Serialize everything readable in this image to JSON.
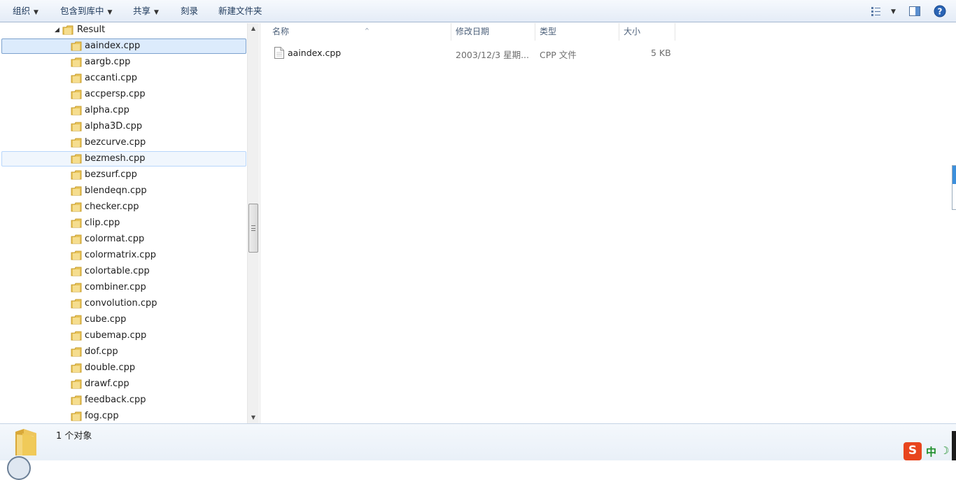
{
  "toolbar": {
    "organize": "组织",
    "include_in_library": "包含到库中",
    "share": "共享",
    "burn": "刻录",
    "new_folder": "新建文件夹",
    "view_icon": "view-list-icon",
    "preview_icon": "preview-pane-icon",
    "help_icon": "help-icon"
  },
  "nav": {
    "root": "Result",
    "items": [
      "aaindex.cpp",
      "aargb.cpp",
      "accanti.cpp",
      "accpersp.cpp",
      "alpha.cpp",
      "alpha3D.cpp",
      "bezcurve.cpp",
      "bezmesh.cpp",
      "bezsurf.cpp",
      "blendeqn.cpp",
      "checker.cpp",
      "clip.cpp",
      "colormat.cpp",
      "colormatrix.cpp",
      "colortable.cpp",
      "combiner.cpp",
      "convolution.cpp",
      "cube.cpp",
      "cubemap.cpp",
      "dof.cpp",
      "double.cpp",
      "drawf.cpp",
      "feedback.cpp",
      "fog.cpp"
    ],
    "selected": "aaindex.cpp",
    "hovered": "bezmesh.cpp"
  },
  "columns": {
    "name": "名称",
    "modified": "修改日期",
    "type": "类型",
    "size": "大小"
  },
  "files": [
    {
      "name": "aaindex.cpp",
      "modified": "2003/12/3 星期...",
      "type": "CPP 文件",
      "size": "5 KB"
    }
  ],
  "details": {
    "count": "1 个对象"
  },
  "ime": {
    "logo": "S",
    "mode": "中",
    "moon": "☽"
  },
  "colors": {
    "toolbar_text": "#1e395b",
    "selection": "#dcebfc",
    "selection_border": "#7da2ce",
    "folder": "#e8c45a"
  }
}
